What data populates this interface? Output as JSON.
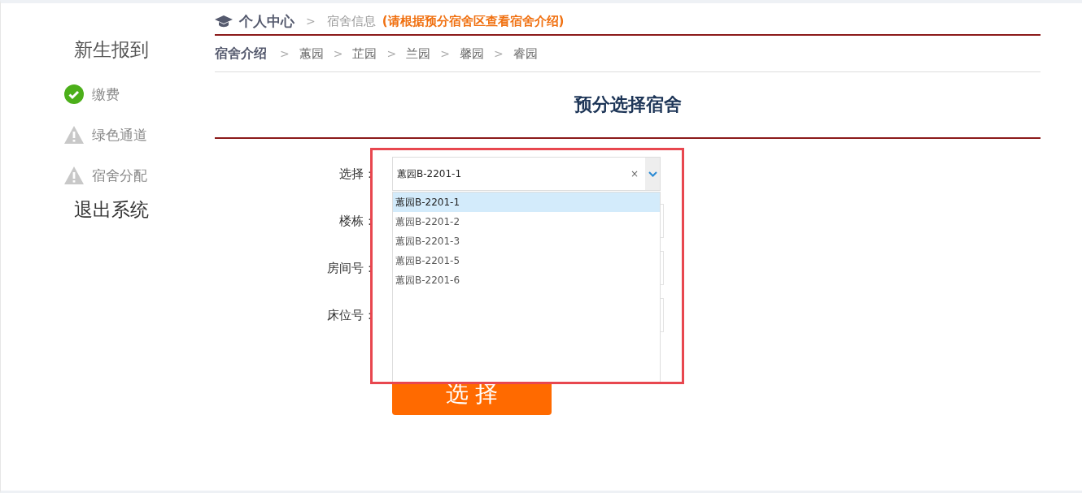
{
  "sidebar": {
    "title": "新生报到",
    "steps": [
      {
        "label": "缴费",
        "kind": "done"
      },
      {
        "label": "绿色通道",
        "kind": "pending"
      },
      {
        "label": "宿舍分配",
        "kind": "pending"
      }
    ],
    "logout": "退出系统"
  },
  "breadcrumb": {
    "home": "个人中心",
    "separator": ">",
    "current": "宿舍信息",
    "note": "(请根据预分宿舍区查看宿舍介绍)"
  },
  "subnav": {
    "title": "宿舍介绍",
    "items": [
      "蕙园",
      "芷园",
      "兰园",
      "馨园",
      "睿园"
    ]
  },
  "heading": "预分选择宿舍",
  "form": {
    "fields": [
      {
        "label": "选择：",
        "value": "蕙园B-2201-1"
      },
      {
        "label": "楼栋："
      },
      {
        "label": "房间号："
      },
      {
        "label": "床位号："
      }
    ],
    "clear": "×",
    "options": [
      {
        "label": "蕙园B-2201-1",
        "selected": true
      },
      {
        "label": "蕙园B-2201-2",
        "selected": false
      },
      {
        "label": "蕙园B-2201-3",
        "selected": false
      },
      {
        "label": "蕙园B-2201-5",
        "selected": false
      },
      {
        "label": "蕙园B-2201-6",
        "selected": false
      }
    ],
    "submit": "选 择"
  }
}
